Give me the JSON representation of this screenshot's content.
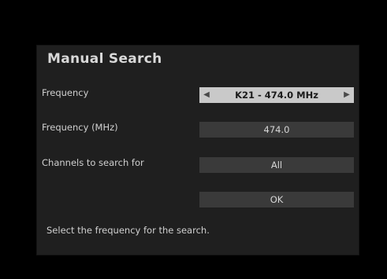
{
  "dialog": {
    "title": "Manual Search",
    "rows": [
      {
        "label": "Frequency",
        "value": "K21 - 474.0 MHz",
        "left_arrow": "◀",
        "right_arrow": "▶"
      },
      {
        "label": "Frequency (MHz)",
        "value": "474.0"
      },
      {
        "label": "Channels to search for",
        "value": "All"
      }
    ],
    "ok_label": "OK",
    "hint": "Select the frequency for the search."
  },
  "colors": {
    "background": "#000000",
    "panel": "#1f1f1f",
    "field": "#3a3a3a",
    "field_selected": "#c9c9c9"
  }
}
